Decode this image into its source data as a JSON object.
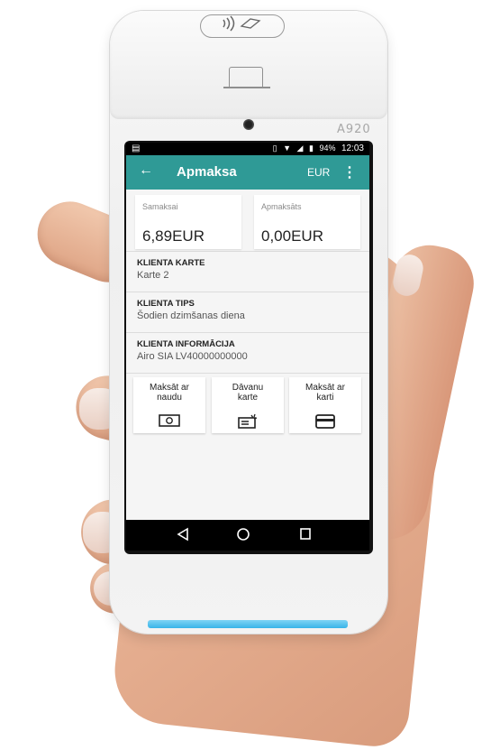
{
  "status_bar": {
    "battery": "94%",
    "time": "12:03"
  },
  "app_bar": {
    "title": "Apmaksa",
    "currency": "EUR"
  },
  "summary": {
    "total_label": "Samaksai",
    "total_value": "6,89EUR",
    "paid_label": "Apmaksāts",
    "paid_value": "0,00EUR"
  },
  "info": [
    {
      "heading": "KLIENTA KARTE",
      "value": "Karte 2"
    },
    {
      "heading": "KLIENTA TIPS",
      "value": "Šodien dzimšanas diena"
    },
    {
      "heading": "KLIENTA INFORMĀCIJA",
      "value": "Airo SIA LV40000000000"
    }
  ],
  "payment_buttons": [
    {
      "line1": "Maksāt ar",
      "line2": "naudu",
      "icon": "banknote-icon"
    },
    {
      "line1": "Dāvanu",
      "line2": "karte",
      "icon": "gift-card-icon"
    },
    {
      "line1": "Maksāt ar",
      "line2": "karti",
      "icon": "credit-card-icon"
    }
  ],
  "device": {
    "brand": "A920",
    "led_color": "#38b4e8"
  },
  "colors": {
    "app_bar": "#2f9a96",
    "background": "#f5f5f5"
  }
}
